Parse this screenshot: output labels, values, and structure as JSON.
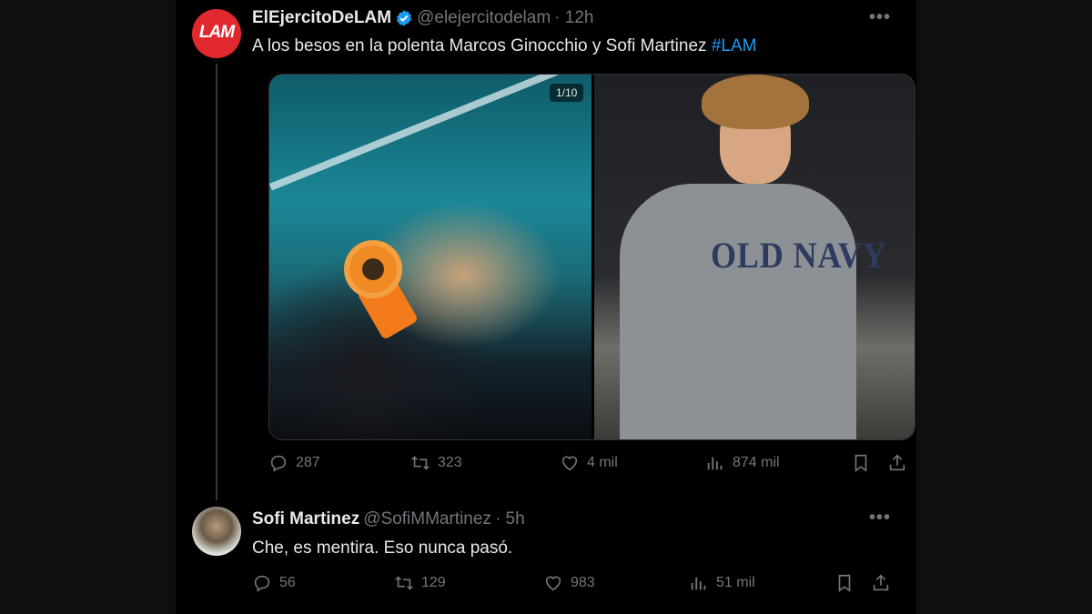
{
  "tweet1": {
    "avatar_text": "LAM",
    "name": "ElEjercitoDeLAM",
    "handle": "@elejercitodelam",
    "time": "· 12h",
    "text": "A los besos en la polenta Marcos Ginocchio y Sofi Martinez",
    "hashtag": "#LAM",
    "media_counter": "1/10",
    "sweater_text": "OLD NAVY",
    "replies": "287",
    "retweets": "323",
    "likes": "4 mil",
    "views": "874 mil"
  },
  "tweet2": {
    "name": "Sofi Martinez",
    "handle": "@SofiMMartinez",
    "time": "· 5h",
    "text": "Che, es mentira. Eso nunca pasó.",
    "replies": "56",
    "retweets": "129",
    "likes": "983",
    "views": "51 mil"
  },
  "icons": [
    "reply-icon",
    "retweet-icon",
    "like-icon",
    "views-icon",
    "bookmark-icon",
    "share-icon",
    "verified-badge-icon",
    "more-icon"
  ],
  "colors": {
    "background": "#000000",
    "text": "#e7e9ea",
    "muted": "#71767b",
    "accent": "#1d9bf0",
    "lam_red": "#e0282e"
  }
}
